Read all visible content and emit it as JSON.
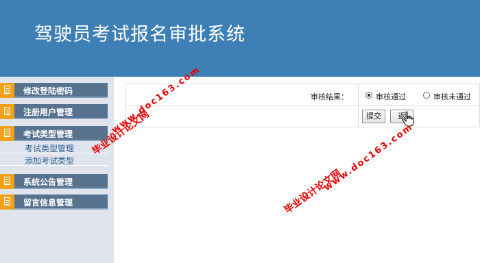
{
  "header": {
    "title": "驾驶员考试报名审批系统"
  },
  "sidebar": {
    "groups": [
      {
        "label": "修改登陆密码"
      },
      {
        "label": "注册用户管理"
      },
      {
        "label": "考试类型管理",
        "items": [
          "考试类型管理",
          "添加考试类型"
        ]
      },
      {
        "label": "系统公告管理"
      },
      {
        "label": "留言信息管理"
      }
    ]
  },
  "form": {
    "result_label": "审核结果：",
    "options": [
      "审核通过",
      "审核未通过"
    ],
    "selected": "审核通过",
    "submit_label": "提交",
    "back_label": "返"
  },
  "watermarks": [
    {
      "cn": "毕业设计论文网",
      "url": "www.doc163.com"
    },
    {
      "cn": "毕业设计论文网",
      "url": "www.doc163.com"
    }
  ],
  "colors": {
    "header": "#3e7fb6",
    "sidebar_group": "#56728f",
    "sidebar_icon": "#f3a11a",
    "watermark": "#e60000"
  }
}
